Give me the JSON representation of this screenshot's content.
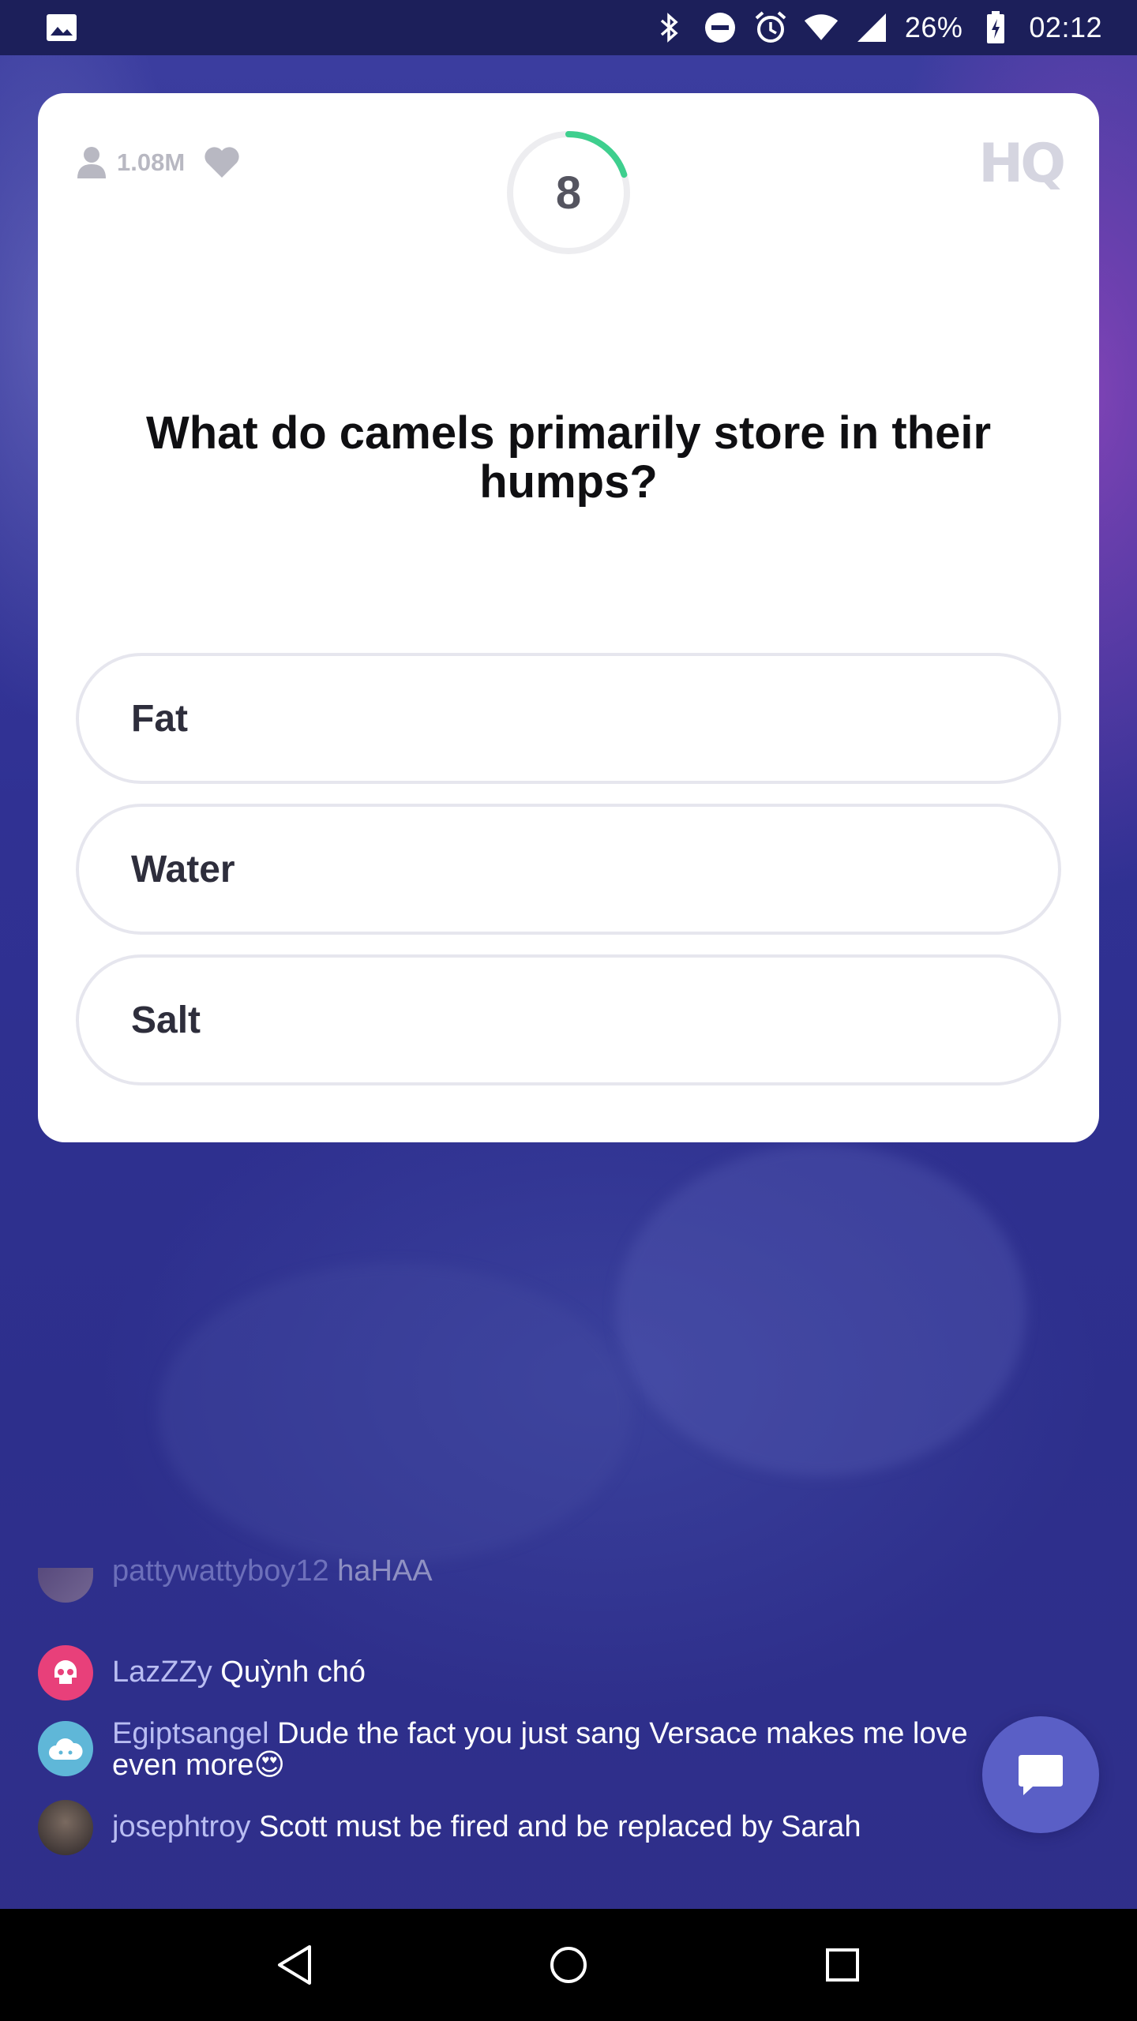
{
  "status_bar": {
    "battery": "26%",
    "time": "02:12",
    "icons": [
      "image-icon",
      "bluetooth-icon",
      "do-not-disturb-icon",
      "alarm-icon",
      "wifi-icon",
      "cell-signal-icon",
      "battery-charging-icon"
    ]
  },
  "card": {
    "viewer_count": "1.08M",
    "timer_value": "8",
    "timer_progress": 0.2,
    "logo": "HQ",
    "question": "What do camels primarily store in their humps?",
    "answers": [
      {
        "label": "Fat"
      },
      {
        "label": "Water"
      },
      {
        "label": "Salt"
      }
    ]
  },
  "chat": {
    "messages": [
      {
        "user": "pattywattyboy12",
        "text": "haHAA",
        "avatar": "photo"
      },
      {
        "user": "LazZZy",
        "text": "Quỳnh chó",
        "avatar": "skull-icon"
      },
      {
        "user": "Egiptsangel",
        "text": "Dude the fact you just sang Versace makes me love even more😍",
        "avatar": "cloud-icon"
      },
      {
        "user": "josephtroy",
        "text": "Scott must be fired and be replaced by Sarah",
        "avatar": "photo"
      }
    ]
  },
  "colors": {
    "timer_accent": "#3ecf8e",
    "chat_button": "#5a5fc6",
    "background": "#2e2f86"
  },
  "nav_bar": {
    "buttons": [
      "back-icon",
      "home-icon",
      "recents-icon"
    ]
  }
}
